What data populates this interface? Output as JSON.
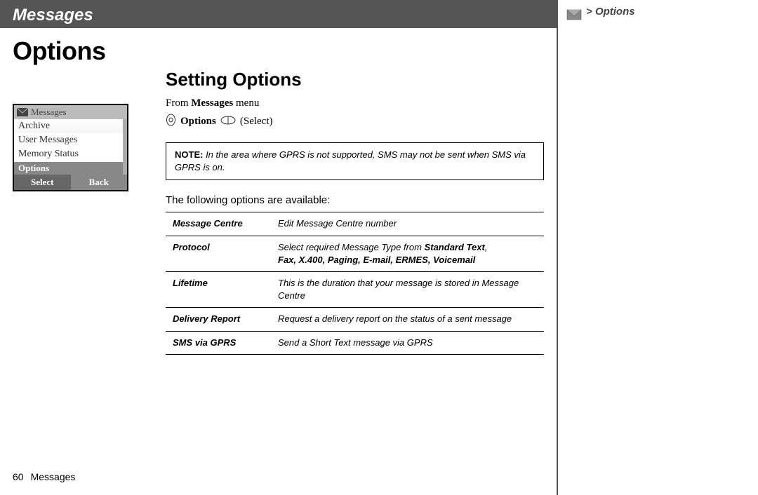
{
  "topBanner": {
    "chapter": "Messages"
  },
  "sidebar": {
    "chevron": ">",
    "label": "Options"
  },
  "pageHeading": "Options",
  "phone": {
    "title": "Messages",
    "items": [
      "Archive",
      "User Messages",
      "Memory Status"
    ],
    "selected": "Options",
    "softLeft": "Select",
    "softRight": "Back"
  },
  "section": {
    "heading": "Setting Options",
    "fromPrefix": "From ",
    "fromBold": "Messages",
    "fromSuffix": " menu",
    "navBold": "Options",
    "navSuffix": "(Select)"
  },
  "note": {
    "label": "NOTE:",
    "text": " In the area where GPRS is not supported, SMS may not be sent when SMS via GPRS is on."
  },
  "optionsIntro": "The following options are available:",
  "options": [
    {
      "name": "Message Centre",
      "desc": "Edit Message Centre number",
      "typesPrefix": "",
      "types": ""
    },
    {
      "name": "Protocol",
      "desc": "Select required Message Type from ",
      "typesPrefix": "Standard Text",
      "types": "Fax, X.400, Paging, E-mail, ERMES, Voicemail"
    },
    {
      "name": "Lifetime",
      "desc": "This is the duration that your message is stored in Message Centre",
      "typesPrefix": "",
      "types": ""
    },
    {
      "name": "Delivery Report",
      "desc": "Request a delivery report on the status of a sent message",
      "typesPrefix": "",
      "types": ""
    },
    {
      "name": "SMS via GPRS",
      "desc": "Send a Short Text message via GPRS",
      "typesPrefix": "",
      "types": ""
    }
  ],
  "footer": {
    "pageNum": "60",
    "section": "Messages"
  }
}
